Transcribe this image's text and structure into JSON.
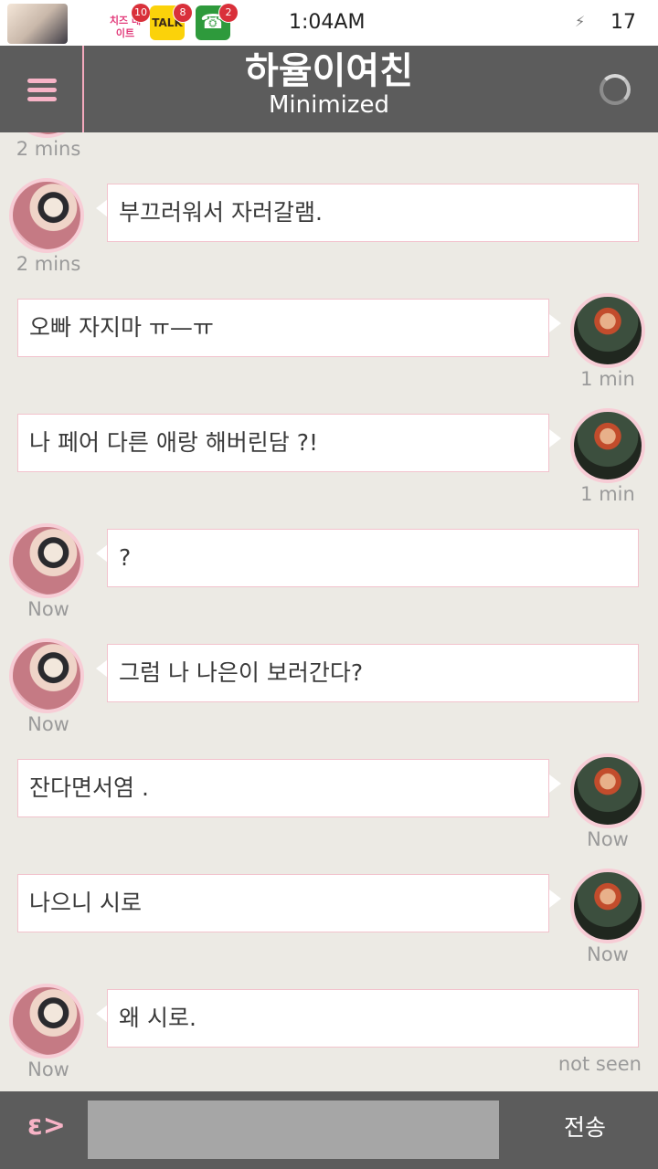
{
  "status_bar": {
    "time": "1:04AM",
    "battery_level": "17",
    "notifications": [
      {
        "name": "calendar-app-icon",
        "label": "치즈 데이트",
        "badge": "10"
      },
      {
        "name": "kakaotalk-icon",
        "label": "TALK",
        "badge": "8"
      },
      {
        "name": "phone-icon",
        "label": "☎",
        "badge": "2"
      }
    ]
  },
  "header": {
    "title": "하율이여친",
    "subtitle": "Minimized"
  },
  "chat": {
    "partial_top_time": "2 mins",
    "messages": [
      {
        "side": "left",
        "text": "부끄러워서 자러갈램.",
        "time": "2 mins"
      },
      {
        "side": "right",
        "text": "오빠 자지마 ㅠ—ㅠ",
        "time": "1 min"
      },
      {
        "side": "right",
        "text": "나 페어 다른 애랑 해버린담 ?!",
        "time": "1 min"
      },
      {
        "side": "left",
        "text": "?",
        "time": "Now"
      },
      {
        "side": "left",
        "text": "그럼 나 나은이 보러간다?",
        "time": "Now"
      },
      {
        "side": "right",
        "text": "잔다면서염 .",
        "time": "Now"
      },
      {
        "side": "right",
        "text": "나으니 시로",
        "time": "Now"
      },
      {
        "side": "left",
        "text": "왜 시로.",
        "time": "Now"
      }
    ],
    "last_status": "not seen"
  },
  "input_bar": {
    "emoji_label": "ε>",
    "message_placeholder": "",
    "send_label": "전송"
  },
  "colors": {
    "header_bg": "#5c5c5c",
    "accent_pink": "#f7b3c6",
    "chat_bg": "#eceae4"
  }
}
